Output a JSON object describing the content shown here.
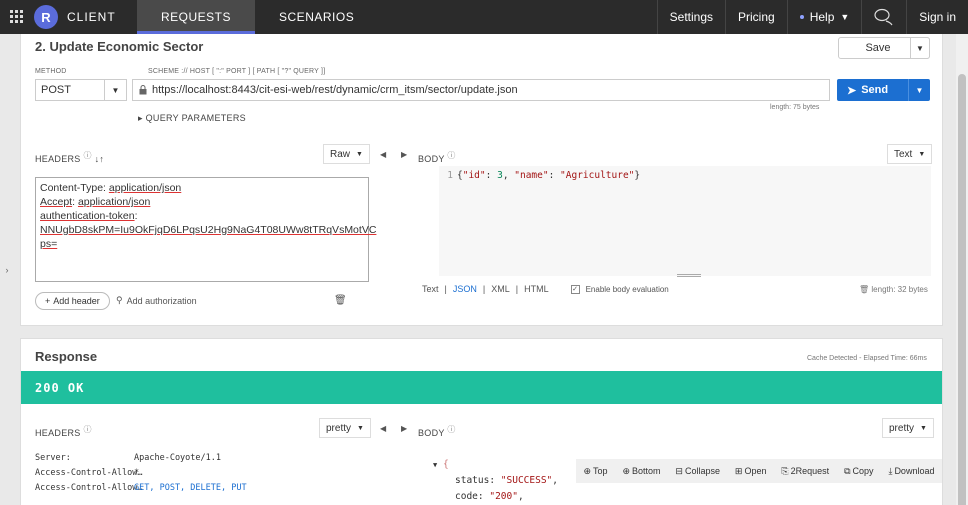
{
  "topbar": {
    "brand_letter": "R",
    "brand": "CLIENT",
    "tabs": [
      {
        "label": "REQUESTS",
        "active": true
      },
      {
        "label": "SCENARIOS",
        "active": false
      }
    ],
    "right": {
      "settings": "Settings",
      "pricing": "Pricing",
      "help": "Help",
      "signin": "Sign in"
    }
  },
  "request": {
    "title": "2. Update Economic Sector",
    "save_label": "Save",
    "method_label": "METHOD",
    "method": "POST",
    "url_label": "SCHEME :// HOST [ \":\" PORT ] [ PATH [ \"?\" QUERY ]]",
    "url": "https://localhost:8443/cit-esi-web/rest/dynamic/crm_itsm/sector/update.json",
    "url_length": "length: 75 bytes",
    "send_label": "Send",
    "query_params": "QUERY PARAMETERS",
    "headers_title": "HEADERS",
    "headers_mode": "Raw",
    "headers_lines": [
      {
        "key": "Content-Type",
        "value": "application/json"
      },
      {
        "key": "Accept",
        "value": "application/json"
      },
      {
        "key": "authentication-token",
        "value": ""
      },
      {
        "key": "",
        "value": "NNUgbD8skPM=Iu9OkFjqD6LPqsU2Hg9NaG4T08UWw8tTRqVsMotVC"
      },
      {
        "key": "",
        "value": "ps="
      }
    ],
    "add_header": "Add header",
    "add_auth": "Add authorization",
    "body_title": "BODY",
    "body_mode": "Text",
    "body_line_no": "1",
    "body_code": {
      "p1": "{",
      "k1": "\"id\"",
      "c1": ": ",
      "v1": "3",
      "c2": ", ",
      "k2": "\"name\"",
      "c3": ": ",
      "v2": "\"Agriculture\"",
      "p2": "}"
    },
    "body_formats": {
      "text": "Text",
      "json": "JSON",
      "xml": "XML",
      "html": "HTML",
      "sep": "|"
    },
    "enable_eval": "Enable body evaluation",
    "body_length": "length: 32 bytes"
  },
  "response": {
    "title": "Response",
    "cache_info": "Cache Detected - Elapsed Time: 66ms",
    "status": "200 OK",
    "headers_title": "HEADERS",
    "headers_mode": "pretty",
    "body_title": "BODY",
    "body_mode": "pretty",
    "header_rows": [
      {
        "key": "Server:",
        "value": "Apache-Coyote/1.1"
      },
      {
        "key": "Access-Control-Allow…",
        "value": "*"
      },
      {
        "key": "Access-Control-Allow…",
        "value": "GET, POST, DELETE, PUT"
      }
    ],
    "json": {
      "open": "{",
      "k1": "status",
      "v1": "\"SUCCESS\"",
      "k2": "code",
      "v2": "\"200\""
    },
    "toolbar": {
      "top": "Top",
      "bottom": "Bottom",
      "collapse": "Collapse",
      "open": "Open",
      "request": "2Request",
      "copy": "Copy",
      "download": "Download"
    }
  }
}
